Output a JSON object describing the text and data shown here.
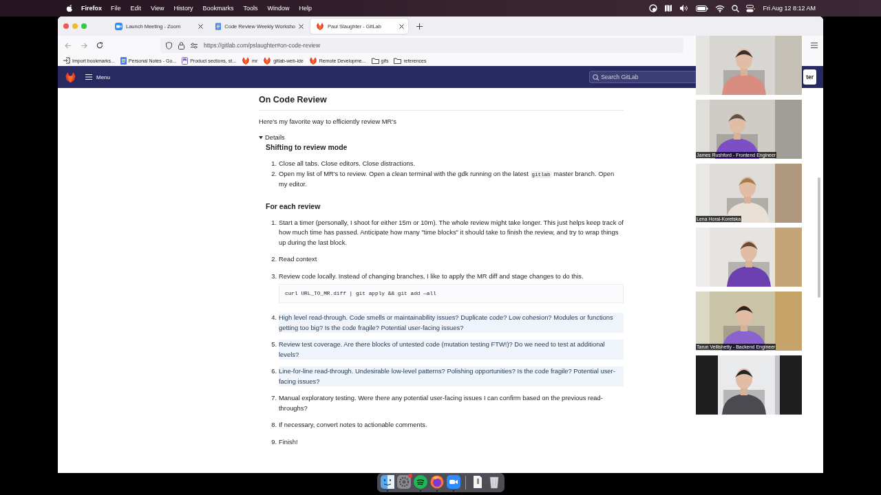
{
  "menu_bar": {
    "app": "Firefox",
    "items": [
      "File",
      "Edit",
      "View",
      "History",
      "Bookmarks",
      "Tools",
      "Window",
      "Help"
    ],
    "clock": "Fri Aug 12  8:12 AM"
  },
  "browser": {
    "tabs": [
      {
        "title": "Launch Meeting - Zoom",
        "kind": "zoom",
        "selected": false
      },
      {
        "title": "Code Review Weekly Worksho",
        "kind": "doc",
        "selected": false
      },
      {
        "title": "Paul Slaughter - GitLab",
        "kind": "fox",
        "selected": true
      }
    ],
    "url": "https://gitlab.com/pslaughter#on-code-review",
    "bookmarks": [
      {
        "label": "Import bookmarks...",
        "kind": "import"
      },
      {
        "label": "Personal Notes - Go...",
        "kind": "doc"
      },
      {
        "label": "Product sections, st...",
        "kind": "page"
      },
      {
        "label": "mr",
        "kind": "fox"
      },
      {
        "label": "gitlab-web-ide",
        "kind": "fox"
      },
      {
        "label": "Remote Developme...",
        "kind": "fox"
      },
      {
        "label": "gifs",
        "kind": "folder"
      },
      {
        "label": "references",
        "kind": "folder"
      }
    ]
  },
  "gitlab": {
    "menu_label": "Menu",
    "search": {
      "placeholder": "Search GitLab"
    },
    "button": "ter"
  },
  "article": {
    "title": "On Code Review",
    "intro": "Here's my favorite way to efficiently review MR's",
    "details": {
      "label": "Details",
      "expanded": true
    },
    "sections": [
      {
        "heading": "Shifting to review mode",
        "items": [
          {
            "number": "1.",
            "parts": [
              {
                "kind": "text",
                "text": "Close all tabs. Close editors. Close distractions."
              }
            ],
            "highlighted": false
          },
          {
            "number": "2.",
            "parts": [
              {
                "kind": "text",
                "text": "Open my list of MR's to review. Open a clean terminal with the gdk running on the latest "
              },
              {
                "kind": "code",
                "text": "gitlab"
              },
              {
                "kind": "text",
                "text": " master branch. Open my editor."
              }
            ],
            "highlighted": false
          }
        ]
      },
      {
        "heading": "For each review",
        "items": [
          {
            "number": "1.",
            "parts": [
              {
                "kind": "text",
                "text": "Start a timer (personally, I shoot for either 15m or 10m). The whole review might take longer. This just helps keep track of how much time has passed. Anticipate how many \"time blocks\" it should take to finish the review, and try to wrap things up during the last block."
              }
            ],
            "highlighted": false
          },
          {
            "number": "2.",
            "parts": [
              {
                "kind": "text",
                "text": "Read context"
              }
            ],
            "highlighted": false
          },
          {
            "number": "3.",
            "parts": [
              {
                "kind": "text",
                "text": "Review code locally. Instead of changing branches, I like to apply the MR diff and stage changes to do this."
              }
            ],
            "code_block": "curl URL_TO_MR.diff | git apply && git add —all",
            "highlighted": false
          },
          {
            "number": "4.",
            "parts": [
              {
                "kind": "text",
                "text": "High level read-through. Code smells or maintainability issues? Duplicate code? Low cohesion? Modules or functions getting too big? Is the code fragile? Potential user-facing issues?"
              }
            ],
            "highlighted": true
          },
          {
            "number": "5.",
            "parts": [
              {
                "kind": "text",
                "text": "Review test coverage. Are there blocks of untested code (mutation testing FTW!)? Do we need to test at additional levels?"
              }
            ],
            "highlighted": true
          },
          {
            "number": "6.",
            "parts": [
              {
                "kind": "text",
                "text": "Line-for-line read-through. Undesirable low-level patterns? Polishing opportunities? Is the code fragile? Potential user-facing issues?"
              }
            ],
            "highlighted": true
          },
          {
            "number": "7.",
            "parts": [
              {
                "kind": "text",
                "text": "Manual exploratory testing. Were there any potential user-facing issues I can confirm based on the previous read-throughs?"
              }
            ],
            "highlighted": false
          },
          {
            "number": "8.",
            "parts": [
              {
                "kind": "text",
                "text": "If necessary, convert notes to actionable comments."
              }
            ],
            "highlighted": false
          },
          {
            "number": "9.",
            "parts": [
              {
                "kind": "text",
                "text": "Finish!"
              }
            ],
            "highlighted": false
          }
        ]
      }
    ]
  },
  "participants": [
    {
      "kind": "video"
    },
    {
      "kind": "video",
      "name_label": "James Rushford - Frontend Engineer"
    },
    {
      "kind": "video",
      "name_label": "Lena Horal-Koretska"
    },
    {
      "kind": "video"
    },
    {
      "kind": "video",
      "name_label": "Tarun Vellishetty - Backend Engineer"
    },
    {
      "kind": "video",
      "letterbox": true
    }
  ],
  "dock": [
    {
      "kind": "finder",
      "running": true,
      "badge": false
    },
    {
      "kind": "settings",
      "running": false,
      "badge": true
    },
    {
      "kind": "spotify",
      "running": true,
      "badge": false
    },
    {
      "kind": "firefox",
      "running": true,
      "badge": false
    },
    {
      "kind": "zoom",
      "running": true,
      "badge": false
    },
    {
      "kind": "separator"
    },
    {
      "kind": "document",
      "running": false,
      "badge": false
    },
    {
      "kind": "trash",
      "running": false,
      "badge": false
    }
  ]
}
